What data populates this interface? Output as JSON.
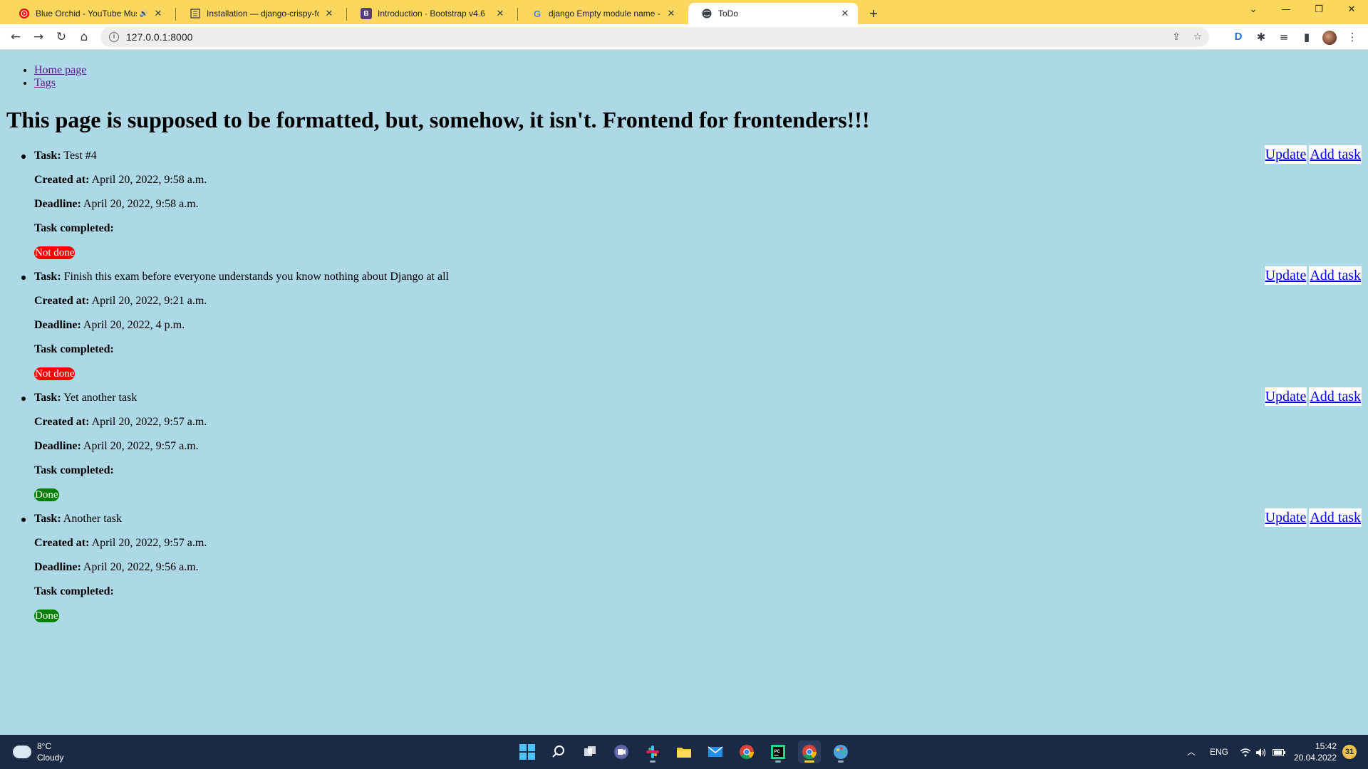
{
  "browser": {
    "tabs": [
      {
        "title": "Blue Orchid - YouTube Music",
        "icon": "youtube-music-icon"
      },
      {
        "title": "Installation — django-crispy-forms",
        "icon": "document-icon"
      },
      {
        "title": "Introduction · Bootstrap v4.6",
        "icon": "bootstrap-icon"
      },
      {
        "title": "django Empty module name - Поиск",
        "icon": "google-icon"
      },
      {
        "title": "ToDo",
        "icon": "globe-icon"
      }
    ],
    "url": "127.0.0.1:8000"
  },
  "page": {
    "nav": [
      {
        "label": "Home page"
      },
      {
        "label": "Tags"
      }
    ],
    "heading": "This page is supposed to be formatted, but, somehow, it isn't. Frontend for frontenders!!!",
    "labels": {
      "task": "Task:",
      "created": "Created at:",
      "deadline": "Deadline:",
      "completed": "Task completed:",
      "update": "Update",
      "add": "Add task"
    },
    "tasks": [
      {
        "name": "Test #4",
        "created": "April 20, 2022, 9:58 a.m.",
        "deadline": "April 20, 2022, 9:58 a.m.",
        "status": "Not done"
      },
      {
        "name": "Finish this exam before everyone understands you know nothing about Django at all",
        "created": "April 20, 2022, 9:21 a.m.",
        "deadline": "April 20, 2022, 4 p.m.",
        "status": "Not done"
      },
      {
        "name": "Yet another task",
        "created": "April 20, 2022, 9:57 a.m.",
        "deadline": "April 20, 2022, 9:57 a.m.",
        "status": "Done"
      },
      {
        "name": "Another task",
        "created": "April 20, 2022, 9:57 a.m.",
        "deadline": "April 20, 2022, 9:56 a.m.",
        "status": "Done"
      }
    ],
    "colors": {
      "background": "#add8e6",
      "not_done": "#ff0000",
      "done": "#008000",
      "link": "#0000ee"
    }
  },
  "taskbar": {
    "weather": {
      "temp": "8°C",
      "condition": "Cloudy"
    },
    "language": "ENG",
    "time": "15:42",
    "date": "20.04.2022",
    "notifications": "31"
  }
}
